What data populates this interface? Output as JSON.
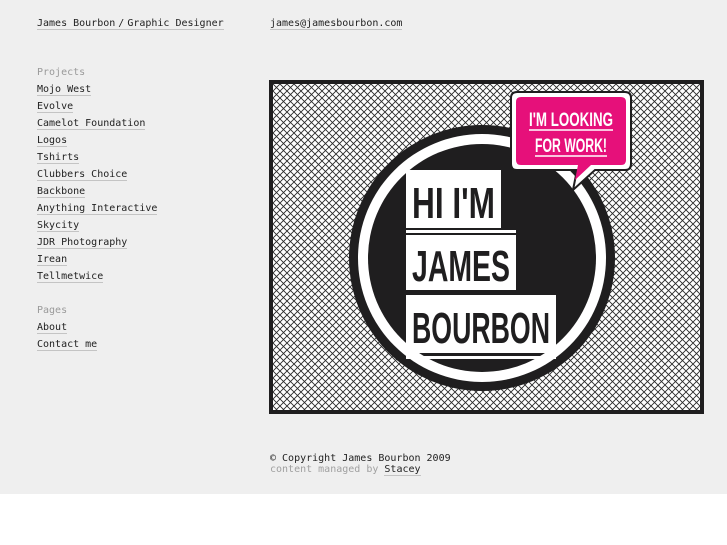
{
  "header": {
    "name": "James Bourbon",
    "separator": "/",
    "role": "Graphic Designer",
    "email": "james@jamesbourbon.com"
  },
  "nav": {
    "projects_heading": "Projects",
    "projects": [
      "Mojo West",
      "Evolve",
      "Camelot Foundation",
      "Logos",
      "Tshirts",
      "Clubbers Choice",
      "Backbone",
      "Anything Interactive",
      "Skycity",
      "JDR Photography",
      "Irean",
      "Tellmetwice"
    ],
    "pages_heading": "Pages",
    "pages": [
      "About",
      "Contact me"
    ]
  },
  "hero": {
    "line1": "HI I'M",
    "line2": "JAMES",
    "line3": "BOURBON",
    "bubble_line1": "I'M LOOKING",
    "bubble_line2": "FOR WORK!"
  },
  "footer": {
    "copyright": "© Copyright James Bourbon 2009",
    "managed_prefix": "content managed by",
    "managed_link": "Stacey"
  },
  "colors": {
    "background": "#efefef",
    "text": "#222222",
    "muted": "#9a9a9a",
    "badge_dark": "#1f1e1f",
    "bubble_pink": "#e6107a"
  }
}
